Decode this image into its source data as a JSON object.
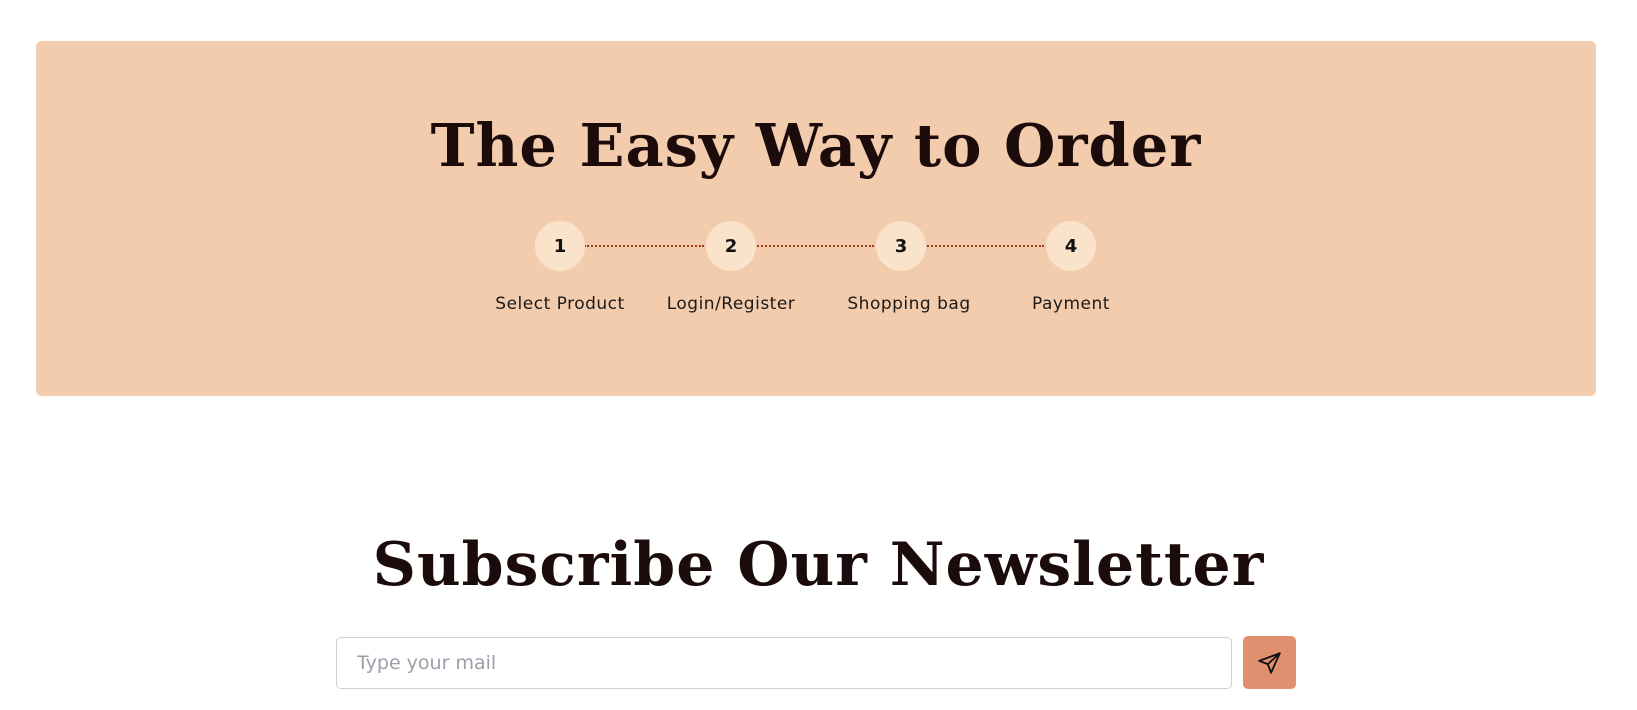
{
  "order": {
    "title": "The Easy Way to Order",
    "steps": [
      {
        "number": "1",
        "label": "Select Product"
      },
      {
        "number": "2",
        "label": "Login/Register"
      },
      {
        "number": "3",
        "label": "Shopping bag"
      },
      {
        "number": "4",
        "label": "Payment"
      }
    ]
  },
  "newsletter": {
    "title": "Subscribe Our Newsletter",
    "placeholder": "Type your mail",
    "send_icon": "send-icon"
  },
  "colors": {
    "order_background": "#f3cbad",
    "step_circle": "#fae3cb",
    "connector": "#9c3a12",
    "send_button": "#e0906e",
    "heading": "#1b0b0b"
  }
}
